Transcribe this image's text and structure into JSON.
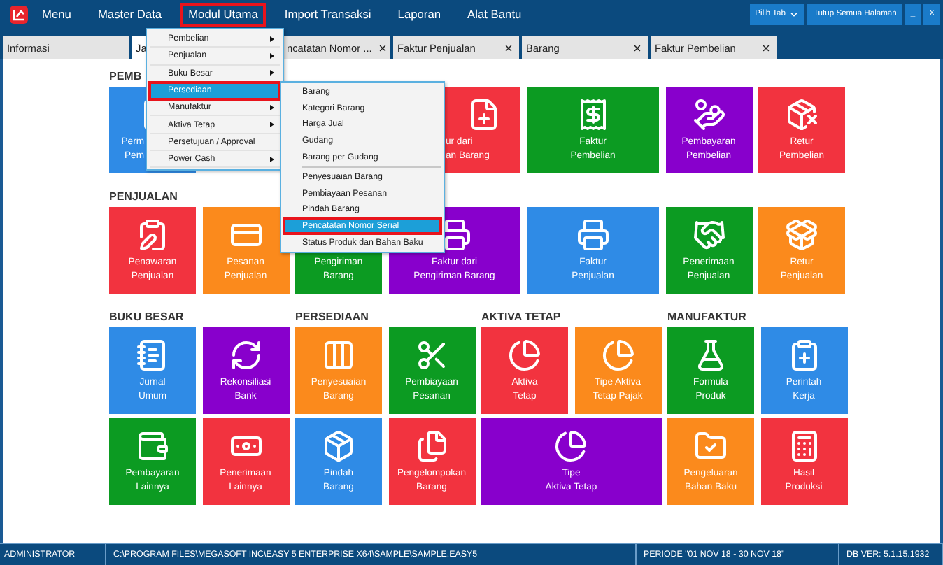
{
  "menubar": {
    "items": [
      {
        "label": "Menu",
        "selected": false
      },
      {
        "label": "Master Data",
        "selected": false
      },
      {
        "label": "Modul Utama",
        "selected": true
      },
      {
        "label": "Import Transaksi",
        "selected": false
      },
      {
        "label": "Laporan",
        "selected": false
      },
      {
        "label": "Alat Bantu",
        "selected": false
      }
    ],
    "buttons": [
      {
        "label": "Pilih Tab",
        "kind": "dropdown"
      },
      {
        "label": "Tutup Semua Halaman",
        "kind": "plain"
      },
      {
        "label": "_",
        "kind": "plain"
      },
      {
        "label": "X",
        "kind": "plain"
      }
    ]
  },
  "tabs": [
    {
      "label": "Informasi",
      "selected": false,
      "kind": "full",
      "closable": false
    },
    {
      "label": "Ja",
      "selected": true,
      "kind": "covered",
      "closable": false
    },
    {
      "label": "ncatatan Nomor ...",
      "selected": false,
      "kind": "cut",
      "closable": true
    },
    {
      "label": "Faktur Penjualan",
      "selected": false,
      "kind": "full",
      "closable": true
    },
    {
      "label": "Barang",
      "selected": false,
      "kind": "full",
      "closable": true
    },
    {
      "label": "Faktur Pembelian",
      "selected": false,
      "kind": "full",
      "closable": true
    }
  ],
  "groups": [
    {
      "headings": [
        "PEMB"
      ],
      "tiles": [
        {
          "kind": "cut-right",
          "color": "#2f8be6",
          "lines": [
            "Perm",
            "Pem"
          ]
        },
        {
          "kind": "covered"
        },
        {
          "kind": "covered"
        },
        {
          "kind": "cut-left",
          "color": "#f2333f",
          "lines": [
            "ur dari",
            "an Barang"
          ]
        },
        {
          "kind": "wide",
          "color": "#0c9b22",
          "lines": [
            "Faktur",
            "Pembelian"
          ]
        },
        {
          "kind": "tile",
          "color": "#8800cc",
          "lines": [
            "Pembayaran",
            "Pembelian"
          ]
        },
        {
          "kind": "tile",
          "color": "#f2333f",
          "lines": [
            "Retur",
            "Pembelian"
          ]
        }
      ]
    },
    {
      "headings": [
        "PENJUALAN"
      ],
      "tiles": [
        {
          "kind": "tile",
          "color": "#f2333f",
          "lines": [
            "Penawaran",
            "Penjualan"
          ]
        },
        {
          "kind": "tile",
          "color": "#fb8a1c",
          "lines": [
            "Pesanan",
            "Penjualan"
          ]
        },
        {
          "kind": "label-only",
          "color": "#0c9b22",
          "lines": [
            "Pengiriman",
            "Barang"
          ]
        },
        {
          "kind": "wide",
          "color": "#8800cc",
          "lines": [
            "Faktur dari",
            "Pengiriman Barang"
          ]
        },
        {
          "kind": "wide",
          "color": "#2f8be6",
          "lines": [
            "Faktur",
            "Penjualan"
          ]
        },
        {
          "kind": "tile",
          "color": "#0c9b22",
          "lines": [
            "Penerimaan",
            "Penjualan"
          ]
        },
        {
          "kind": "tile",
          "color": "#fb8a1c",
          "lines": [
            "Retur",
            "Penjualan"
          ]
        }
      ]
    },
    {
      "headings": [
        "BUKU BESAR",
        "PERSEDIAAN",
        "AKTIVA TETAP",
        "MANUFAKTUR"
      ],
      "tiles": [
        {
          "kind": "tile",
          "color": "#2f8be6",
          "lines": [
            "Jurnal",
            "Umum"
          ]
        },
        {
          "kind": "tile",
          "color": "#8800cc",
          "lines": [
            "Rekonsiliasi",
            "Bank"
          ]
        },
        {
          "kind": "tile",
          "color": "#fb8a1c",
          "lines": [
            "Penyesuaian",
            "Barang"
          ]
        },
        {
          "kind": "tile",
          "color": "#0c9b22",
          "lines": [
            "Pembiayaan",
            "Pesanan"
          ]
        },
        {
          "kind": "tile",
          "color": "#f2333f",
          "lines": [
            "Aktiva",
            "Tetap"
          ]
        },
        {
          "kind": "tile",
          "color": "#fb8a1c",
          "lines": [
            "Tipe Aktiva",
            "Tetap Pajak"
          ]
        },
        {
          "kind": "tile",
          "color": "#0c9b22",
          "lines": [
            "Formula",
            "Produk"
          ]
        },
        {
          "kind": "tile",
          "color": "#2f8be6",
          "lines": [
            "Perintah",
            "Kerja"
          ]
        }
      ]
    },
    {
      "tiles": [
        {
          "kind": "tile",
          "color": "#0c9b22",
          "lines": [
            "Pembayaran",
            "Lainnya"
          ]
        },
        {
          "kind": "tile",
          "color": "#f2333f",
          "lines": [
            "Penerimaan",
            "Lainnya"
          ]
        },
        {
          "kind": "tile",
          "color": "#2f8be6",
          "lines": [
            "Pindah",
            "Barang"
          ]
        },
        {
          "kind": "tile",
          "color": "#f2333f",
          "lines": [
            "Pengelompokan",
            "Barang"
          ]
        },
        {
          "kind": "double",
          "color": "#8800cc",
          "lines": [
            "Tipe",
            "Aktiva Tetap"
          ]
        },
        {
          "kind": "tile",
          "color": "#fb8a1c",
          "lines": [
            "Pengeluaran",
            "Bahan Baku"
          ]
        },
        {
          "kind": "tile",
          "color": "#f2333f",
          "lines": [
            "Hasil",
            "Produksi"
          ]
        }
      ]
    }
  ],
  "menu": {
    "items": [
      {
        "label": "Pembelian",
        "has_submenu": true,
        "selected": false
      },
      {
        "label": "Penjualan",
        "has_submenu": true,
        "selected": false
      },
      {
        "label": "Buku Besar",
        "has_submenu": true,
        "selected": false
      },
      {
        "label": "Persediaan",
        "has_submenu": false,
        "selected": true
      },
      {
        "label": "Manufaktur",
        "has_submenu": true,
        "selected": false
      },
      {
        "label": "Aktiva Tetap",
        "has_submenu": true,
        "selected": false
      },
      {
        "label": "Persetujuan / Approval",
        "has_submenu": false,
        "selected": false
      },
      {
        "label": "Power Cash",
        "has_submenu": true,
        "selected": false
      }
    ]
  },
  "submenu": {
    "groups": [
      [
        {
          "label": "Barang",
          "selected": false
        },
        {
          "label": "Kategori Barang",
          "selected": false
        },
        {
          "label": "Harga Jual",
          "selected": false
        },
        {
          "label": "Gudang",
          "selected": false
        },
        {
          "label": "Barang per Gudang",
          "selected": false
        }
      ],
      [
        {
          "label": "Penyesuaian Barang",
          "selected": false
        },
        {
          "label": "Pembiayaan Pesanan",
          "selected": false
        },
        {
          "label": "Pindah Barang",
          "selected": false
        },
        {
          "label": "Pencatatan Nomor Serial",
          "selected": true
        },
        {
          "label": "Status Produk dan Bahan Baku",
          "selected": false
        }
      ]
    ]
  },
  "status_bar": [
    "ADMINISTRATOR",
    "C:\\PROGRAM FILES\\MEGASOFT INC\\EASY 5 ENTERPRISE X64\\SAMPLE\\SAMPLE.EASY5",
    "PERIODE \"01 NOV 18 - 30 NOV 18\"",
    "DB VER: 5.1.15.1932"
  ]
}
